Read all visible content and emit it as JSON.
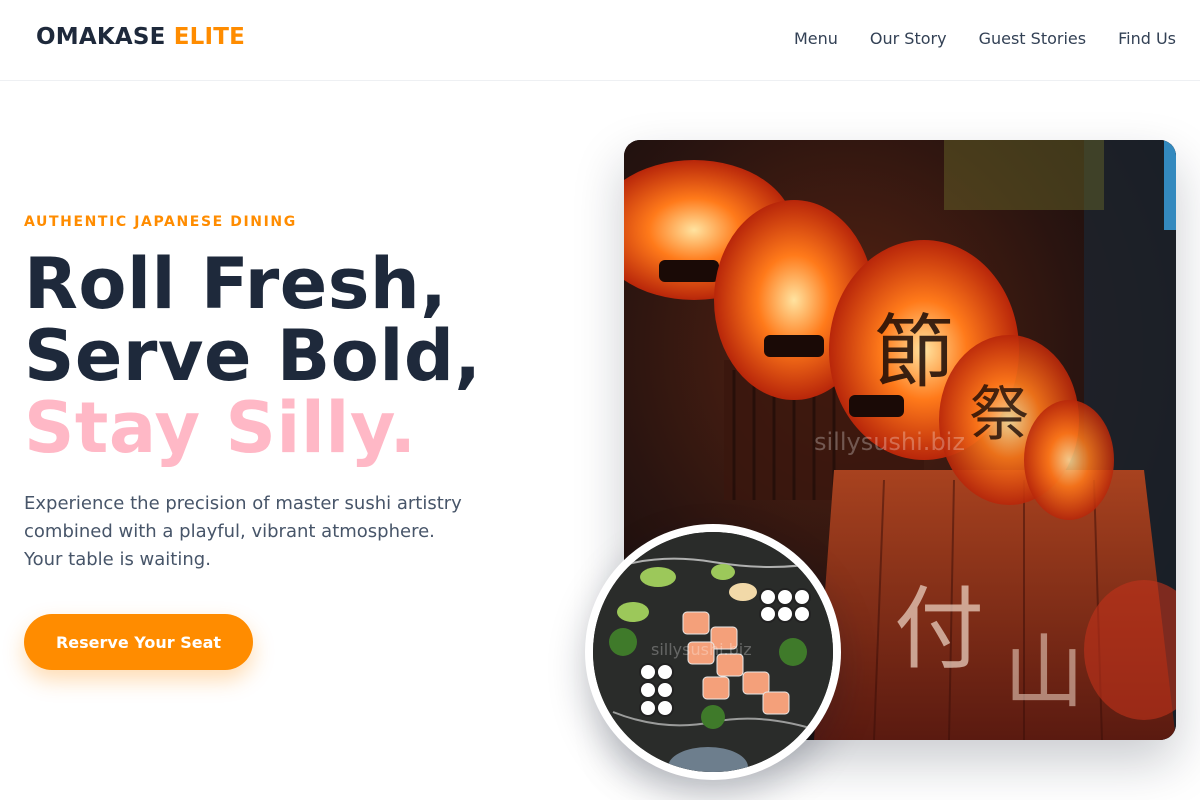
{
  "brand": {
    "name_primary": "OMAKASE",
    "name_accent": "ELITE",
    "accent_color": "#ff8c00"
  },
  "nav": {
    "items": [
      "Menu",
      "Our Story",
      "Guest Stories",
      "Find Us"
    ]
  },
  "hero": {
    "eyebrow": "AUTHENTIC JAPANESE DINING",
    "headline_line1": "Roll Fresh,",
    "headline_line2": "Serve Bold,",
    "headline_line3": "Stay Silly.",
    "description_line1": "Experience the precision of master sushi artistry",
    "description_line2": "combined with a playful, vibrant atmosphere.",
    "description_line3": "Your table is waiting.",
    "cta_label": "Reserve Your Seat"
  },
  "media": {
    "main_photo_watermark": "sillysushi.biz",
    "plate_photo_watermark": "sillysushi.biz"
  },
  "colors": {
    "heading": "#1e293b",
    "accent": "#ff8c00",
    "highlight": "#ffb8c6",
    "body": "#475569"
  }
}
